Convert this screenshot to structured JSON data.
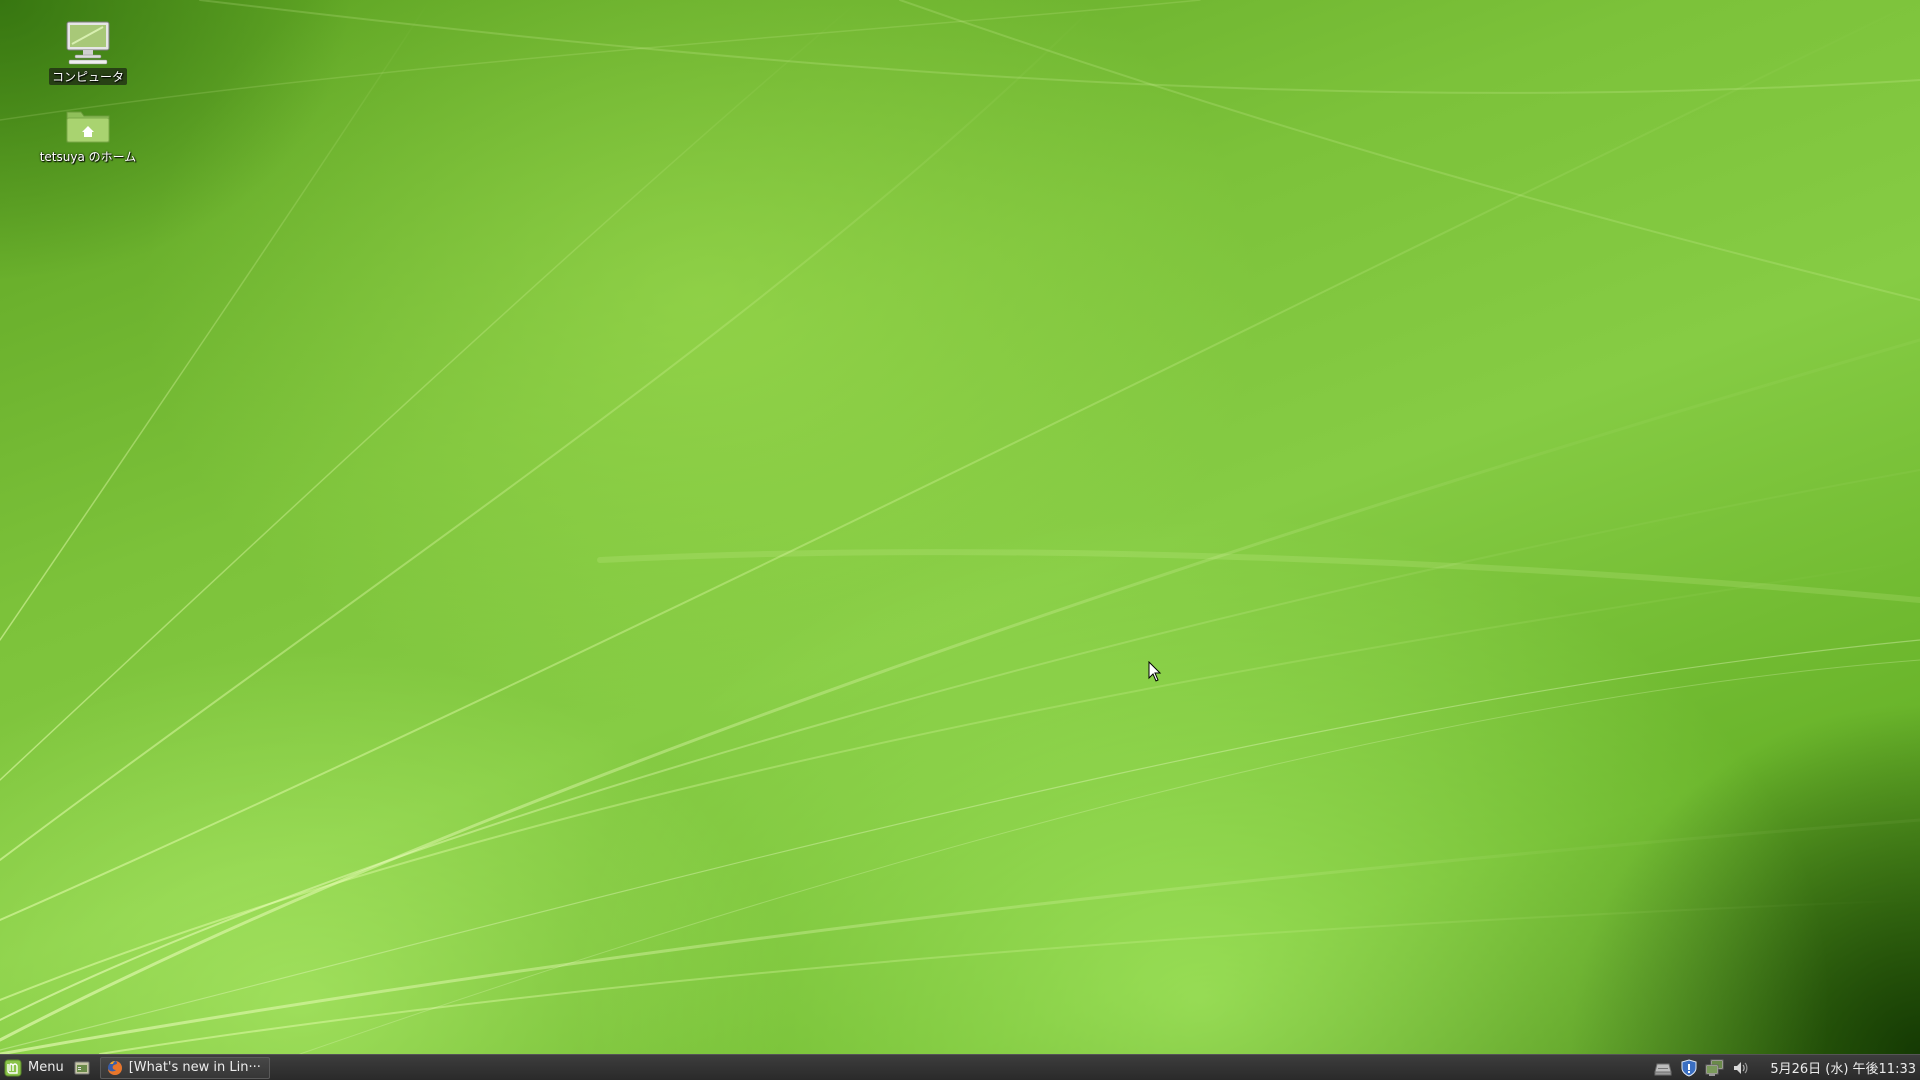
{
  "desktop": {
    "icons": [
      {
        "label": "コンピュータ",
        "icon": "computer-icon"
      },
      {
        "label": "tetsuya のホーム",
        "icon": "home-folder-icon"
      }
    ]
  },
  "taskbar": {
    "menu_label": "Menu",
    "menu_icon": "linux-mint-logo-icon",
    "show_desktop_icon": "show-desktop-icon",
    "window_title": "[What's new in Lin···",
    "window_icon": "firefox-icon",
    "tray_icons": [
      "network-drive-icon",
      "update-shield-icon",
      "network-icon",
      "volume-icon"
    ],
    "clock": "5月26日 (水) 午後11:33"
  },
  "colors": {
    "wallpaper_base": "#7cc23a",
    "panel": "#333333",
    "panel_text": "#ececec"
  }
}
